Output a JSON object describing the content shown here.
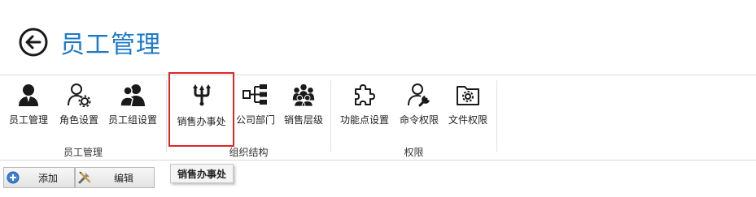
{
  "header": {
    "title": "员工管理",
    "back_icon": "back-arrow-icon",
    "title_color": "#1e7ac8"
  },
  "ribbon": {
    "groups": [
      {
        "label": "员工管理",
        "buttons": [
          {
            "label": "员工管理",
            "icon": "employee-icon"
          },
          {
            "label": "角色设置",
            "icon": "role-settings-icon"
          },
          {
            "label": "员工组设置",
            "icon": "user-group-icon"
          }
        ]
      },
      {
        "label": "组织结构",
        "buttons": [
          {
            "label": "销售办事处",
            "icon": "sales-office-icon",
            "selected": true
          },
          {
            "label": "公司部门",
            "icon": "org-chart-icon"
          },
          {
            "label": "销售层级",
            "icon": "sales-hierarchy-icon"
          }
        ]
      },
      {
        "label": "权限",
        "buttons": [
          {
            "label": "功能点设置",
            "icon": "puzzle-icon"
          },
          {
            "label": "命令权限",
            "icon": "user-wrench-icon"
          },
          {
            "label": "文件权限",
            "icon": "folder-gear-icon"
          }
        ]
      }
    ],
    "highlight_color": "#e02424"
  },
  "toolbar": {
    "add_label": "添加",
    "edit_label": "编辑",
    "add_icon": "plus-circle-icon",
    "edit_icon": "tools-icon"
  },
  "tooltip": {
    "text": "销售办事处"
  }
}
